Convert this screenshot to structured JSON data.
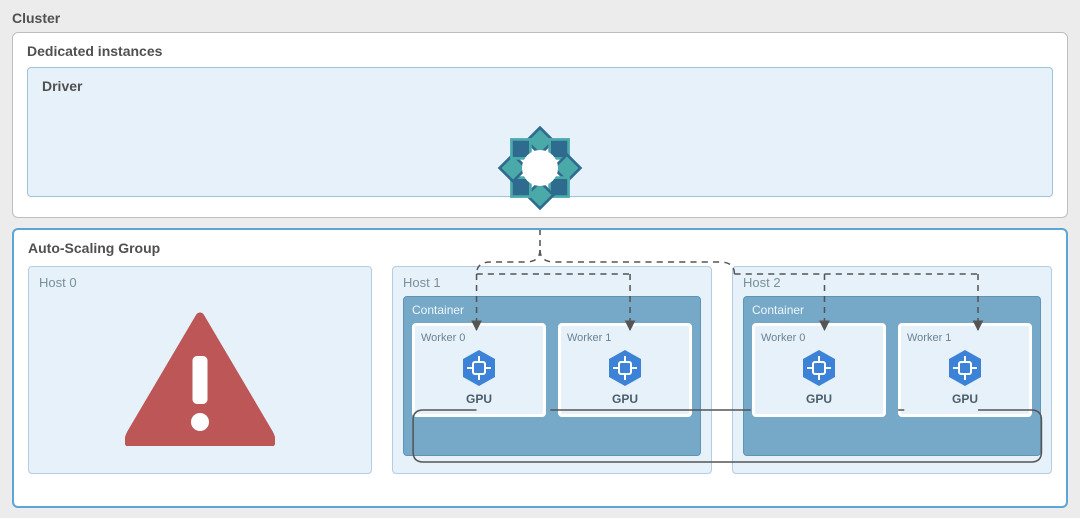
{
  "cluster": {
    "title": "Cluster"
  },
  "dedicated": {
    "title": "Dedicated instances",
    "driver": {
      "title": "Driver"
    }
  },
  "autoscale": {
    "title": "Auto-Scaling Group",
    "hosts": [
      {
        "label": "Host 0",
        "state": "error"
      },
      {
        "label": "Host 1",
        "container": {
          "label": "Container",
          "workers": [
            {
              "label": "Worker 0",
              "device": "GPU"
            },
            {
              "label": "Worker 1",
              "device": "GPU"
            }
          ]
        }
      },
      {
        "label": "Host 2",
        "container": {
          "label": "Container",
          "workers": [
            {
              "label": "Worker 0",
              "device": "GPU"
            },
            {
              "label": "Worker 1",
              "device": "GPU"
            }
          ]
        }
      }
    ]
  },
  "icons": {
    "driver_logo": "ring-logo",
    "error": "warning-triangle",
    "device": "cpu-chip"
  },
  "colors": {
    "accent": "#5aa6d6",
    "pale": "#e7f1f9",
    "container": "#76a8c8",
    "error": "#bd5656",
    "chip": "#3c82d6"
  }
}
